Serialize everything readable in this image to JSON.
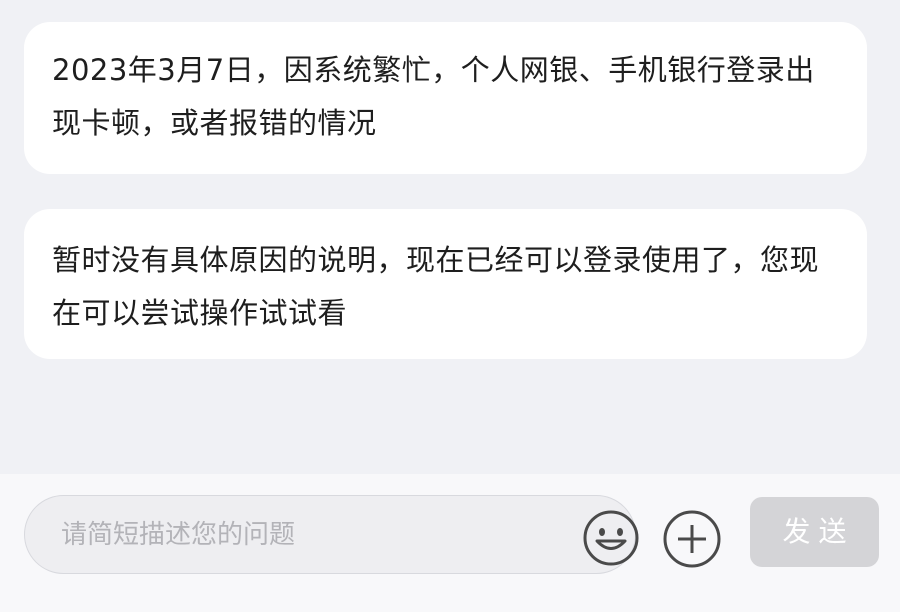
{
  "messages": [
    {
      "text": "2023年3月7日，因系统繁忙，个人网银、手机银行登录出现卡顿，或者报错的情况"
    },
    {
      "text": "暂时没有具体原因的说明，现在已经可以登录使用了，您现在可以尝试操作试试看"
    }
  ],
  "composer": {
    "placeholder": "请简短描述您的问题",
    "value": "",
    "emoji_icon": "smiley-face-icon",
    "add_icon": "plus-circle-icon",
    "send_label": "发送"
  },
  "colors": {
    "background": "#f0f1f5",
    "bubble": "#ffffff",
    "send_disabled": "#d4d4d7",
    "icon": "#4a4a4a"
  }
}
